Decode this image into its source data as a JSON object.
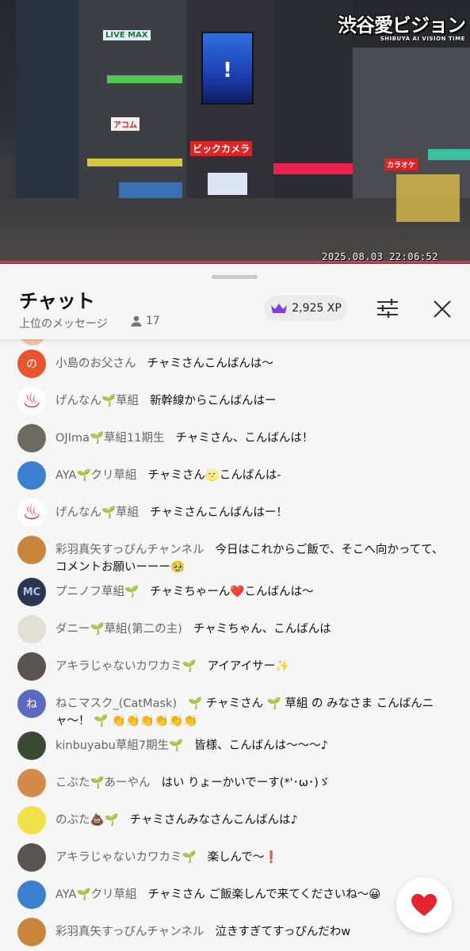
{
  "video": {
    "logo_text": "渋谷愛ビジョン",
    "logo_sub": "SHIBUYA AI VISION TIME",
    "timestamp": "2025.08.03 22:06:52",
    "signs": [
      "LIVE MAX",
      "アコム",
      "ビックカメラ",
      "カラオケ"
    ],
    "screen_symbol": "!"
  },
  "chat": {
    "title": "チャット",
    "subtitle": "上位のメッセージ",
    "viewer_count": "17",
    "xp_label": "2,925 XP",
    "accent_color": "#7b3fe4",
    "heart_color": "#e52430"
  },
  "messages": [
    {
      "avatar_icon": "letter-avatar",
      "avatar_text": "の",
      "avatar_color": "#e8552d",
      "author": "小島のお父さん",
      "text": "チャミさんこんばんは〜"
    },
    {
      "avatar_icon": "onsen-icon",
      "avatar_text": "♨",
      "avatar_color": "#ffffff",
      "author": "げんなん🌱草組",
      "text": "新幹線からこんばんはー"
    },
    {
      "avatar_icon": "cat-photo-avatar",
      "avatar_text": "",
      "avatar_color": "#6f6a60",
      "author": "OJIma🌱草組11期生",
      "text": "チャミさん、こんばんは！"
    },
    {
      "avatar_icon": "mountain-avatar",
      "avatar_text": "",
      "avatar_color": "#3b7fd0",
      "author": "AYA🌱クリ草組",
      "text": "チャミさん🌝こんばんは-"
    },
    {
      "avatar_icon": "onsen-icon",
      "avatar_text": "♨",
      "avatar_color": "#ffffff",
      "author": "げんなん🌱草組",
      "text": "チャミさんこんばんはー！"
    },
    {
      "avatar_icon": "monkey-avatar",
      "avatar_text": "",
      "avatar_color": "#c8863a",
      "author": "彩羽真矢すっぴんチャンネル",
      "text": "今日はこれからご飯で、そこへ向かってて、コメントお願いーーー🥹"
    },
    {
      "avatar_icon": "mc-logo-avatar",
      "avatar_text": "MC",
      "avatar_color": "#2a3550",
      "author": "プニノフ草組🌱",
      "text": "チャミちゃーん❤️こんばんは〜"
    },
    {
      "avatar_icon": "sketch-avatar",
      "avatar_text": "",
      "avatar_color": "#e4e0d8",
      "author": "ダニー🌱草組(第二の主)",
      "text": "チャミちゃん、こんばんは"
    },
    {
      "avatar_icon": "person-photo-avatar",
      "avatar_text": "",
      "avatar_color": "#5a5450",
      "author": "アキラじゃないカワカミ🌱",
      "text": "アイアイサー✨"
    },
    {
      "avatar_icon": "letter-avatar",
      "avatar_text": "ね",
      "avatar_color": "#5c6bc0",
      "author": "ねこマスク_(CatMask)",
      "text": "🌱 チャミさん 🌱 草組 の みなさま こんばんニャ〜！ 🌱 👏👏👏👏👏👏"
    },
    {
      "avatar_icon": "flower-photo-avatar",
      "avatar_text": "",
      "avatar_color": "#3c4a34",
      "author": "kinbuyabu草組7期生🌱",
      "text": "皆様、こんばんは〜〜〜♪"
    },
    {
      "avatar_icon": "monkey-avatar",
      "avatar_text": "",
      "avatar_color": "#d48a48",
      "author": "こぶた🌱あーやん",
      "text": "はい りょーかいでーす(*'･ω･)ゞ"
    },
    {
      "avatar_icon": "person-icon-avatar",
      "avatar_text": "",
      "avatar_color": "#f2e24a",
      "author": "のぶた💩🌱",
      "text": "チャミさんみなさんこんばんは♪"
    },
    {
      "avatar_icon": "person-photo-avatar",
      "avatar_text": "",
      "avatar_color": "#5a5450",
      "author": "アキラじゃないカワカミ🌱",
      "text": "楽しんで〜❗"
    },
    {
      "avatar_icon": "mountain-avatar",
      "avatar_text": "",
      "avatar_color": "#3b7fd0",
      "author": "AYA🌱クリ草組",
      "text": "チャミさん ご飯楽しんで来てくださいね〜😀"
    },
    {
      "avatar_icon": "monkey-avatar",
      "avatar_text": "",
      "avatar_color": "#c8863a",
      "author": "彩羽真矢すっぴんチャンネル",
      "text": "泣きすぎてすっぴんだわw"
    }
  ]
}
